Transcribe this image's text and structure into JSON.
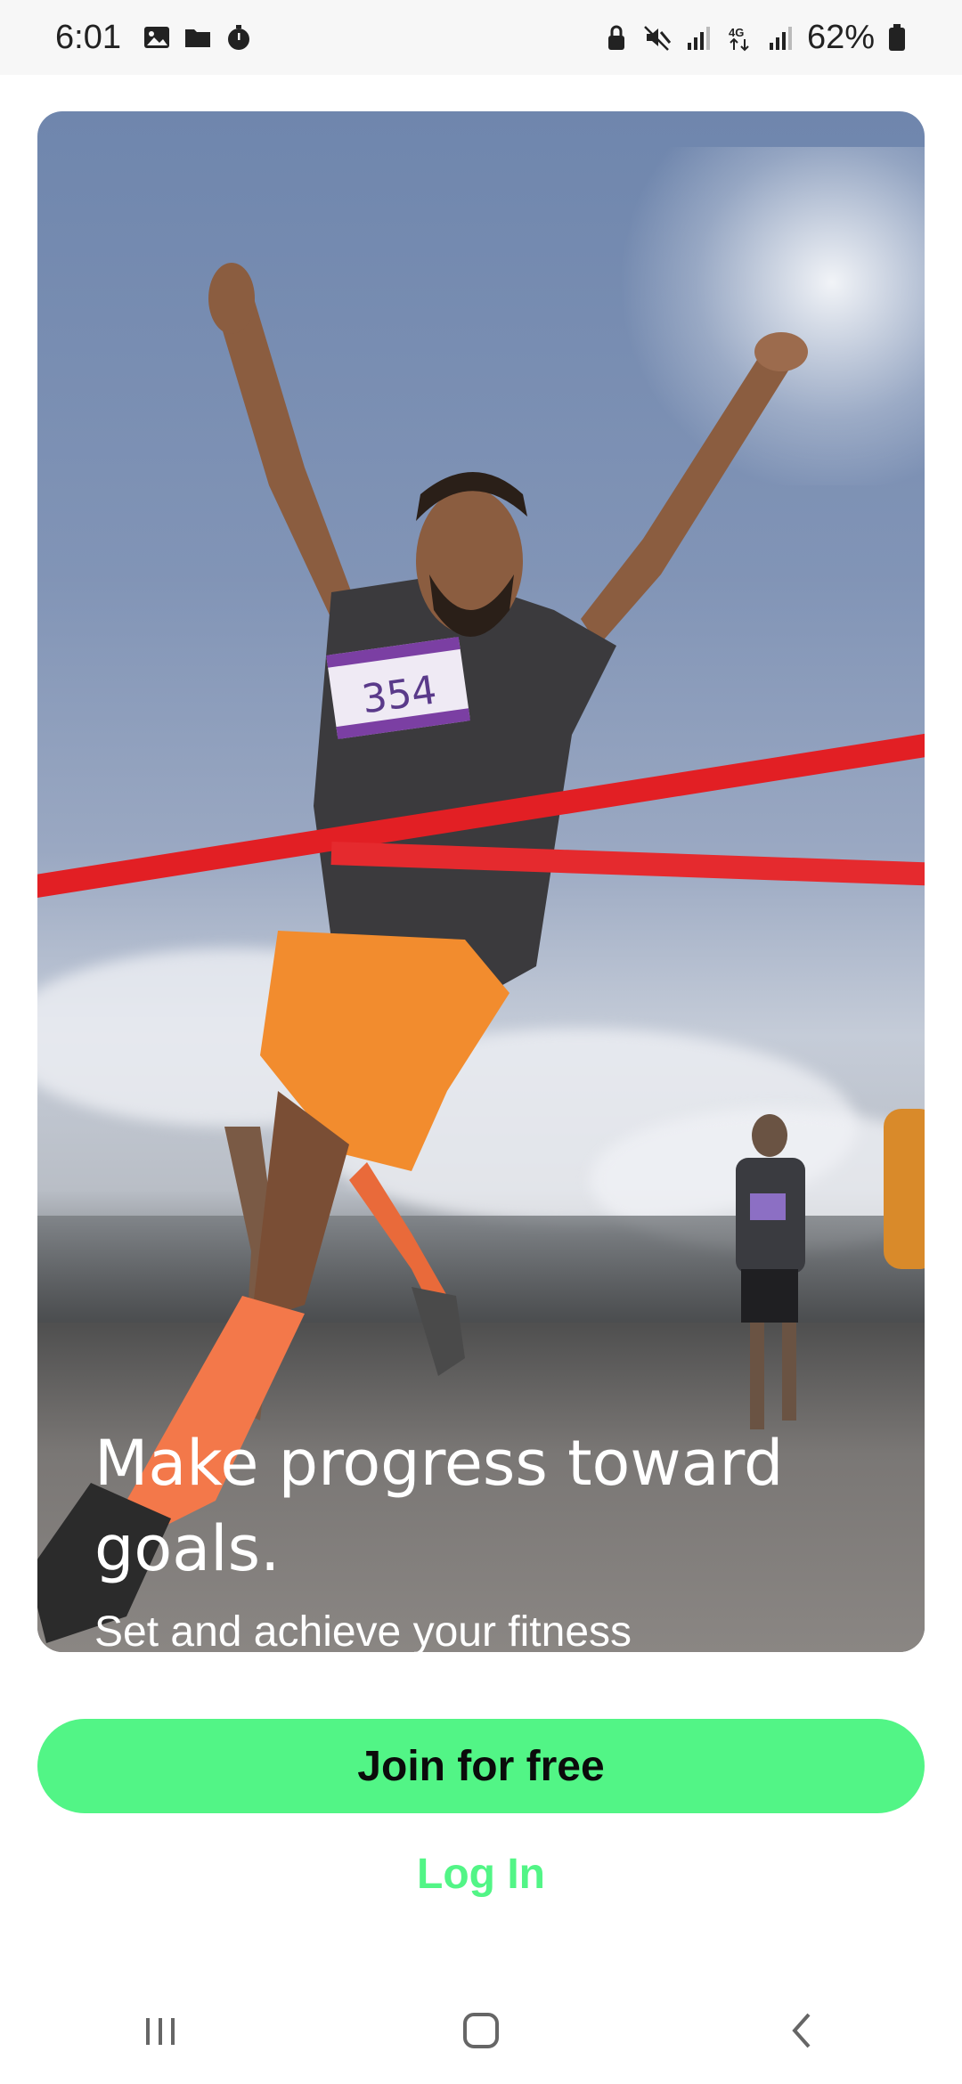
{
  "status_bar": {
    "time": "6:01",
    "battery_percent": "62%",
    "left_icons": [
      "gallery-icon",
      "folder-icon",
      "stopwatch-icon"
    ],
    "right_icons": [
      "lock-icon",
      "mute-icon",
      "signal-icon",
      "4g-icon",
      "signal-icon",
      "battery-icon"
    ]
  },
  "hero": {
    "title": "Make progress toward goals.",
    "subtitle": "Set and achieve your fitness milestones",
    "bib_number": "354",
    "carousel": {
      "count": 3,
      "active_index": 1
    }
  },
  "actions": {
    "join_label": "Join for free",
    "login_label": "Log In"
  },
  "nav": {
    "icons": [
      "recent-apps-icon",
      "home-icon",
      "back-icon"
    ]
  },
  "colors": {
    "accent": "#52f586",
    "status_bar_bg": "#f7f7f7",
    "ribbon": "#e21f24"
  }
}
